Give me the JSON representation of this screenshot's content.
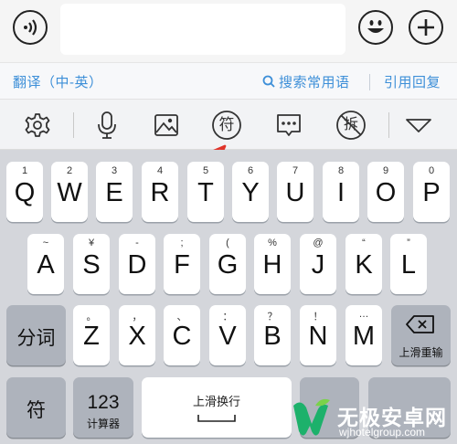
{
  "chatbar": {
    "voice_icon": "voice-wave-icon",
    "emoji_icon": "smiley-icon",
    "plus_icon": "plus-icon",
    "input_value": ""
  },
  "strip": {
    "translate": "翻译（中-英）",
    "search_phrases": "搜索常用语",
    "quote_reply": "引用回复",
    "search_icon": "search-icon"
  },
  "toolbar": {
    "icons": [
      "gear-icon",
      "microphone-icon",
      "image-icon",
      "symbol-icon",
      "ellipsis-chat-icon",
      "no-split-icon",
      "collapse-triangle-icon"
    ],
    "symbol_glyph": "符",
    "split_glyph": "拆"
  },
  "keyboard": {
    "row1": [
      {
        "letter": "Q",
        "sub": "1"
      },
      {
        "letter": "W",
        "sub": "2"
      },
      {
        "letter": "E",
        "sub": "3"
      },
      {
        "letter": "R",
        "sub": "4"
      },
      {
        "letter": "T",
        "sub": "5"
      },
      {
        "letter": "Y",
        "sub": "6"
      },
      {
        "letter": "U",
        "sub": "7"
      },
      {
        "letter": "I",
        "sub": "8"
      },
      {
        "letter": "O",
        "sub": "9"
      },
      {
        "letter": "P",
        "sub": "0"
      }
    ],
    "row2": [
      {
        "letter": "A",
        "sub": "~"
      },
      {
        "letter": "S",
        "sub": "¥"
      },
      {
        "letter": "D",
        "sub": "-"
      },
      {
        "letter": "F",
        "sub": ";"
      },
      {
        "letter": "G",
        "sub": "("
      },
      {
        "letter": "H",
        "sub": "%"
      },
      {
        "letter": "J",
        "sub": "@"
      },
      {
        "letter": "K",
        "sub": "“"
      },
      {
        "letter": "L",
        "sub": "”"
      }
    ],
    "row3": [
      {
        "letter": "Z",
        "sub": "。"
      },
      {
        "letter": "X",
        "sub": "，"
      },
      {
        "letter": "C",
        "sub": "、"
      },
      {
        "letter": "V",
        "sub": "："
      },
      {
        "letter": "B",
        "sub": "？"
      },
      {
        "letter": "N",
        "sub": "！"
      },
      {
        "letter": "M",
        "sub": "…"
      }
    ],
    "segment_key": "分词",
    "delete_hint": "上滑重输",
    "delete_icon": "backspace-icon",
    "symbol_key": "符",
    "num_key_main": "123",
    "num_key_sub": "计算器",
    "space_hint": "上滑换行"
  },
  "watermark": {
    "brand": "无极安卓网",
    "url": "wjhotelgroup.com",
    "logo": "w-leaf-logo"
  },
  "colors": {
    "accent_blue": "#3d8fd8",
    "arrow_red": "#e0342a",
    "logo_green": "#1db16b"
  }
}
